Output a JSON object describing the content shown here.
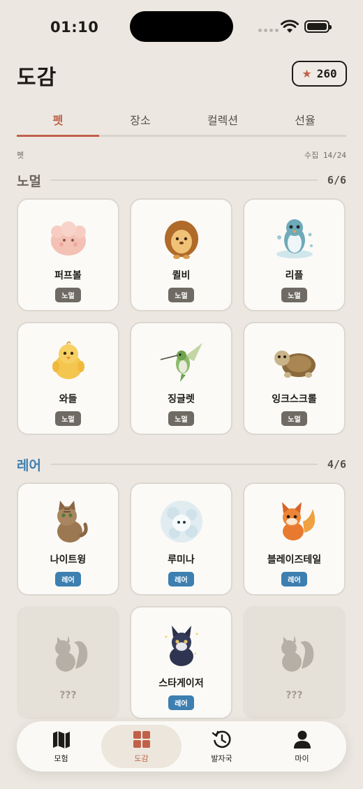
{
  "status_bar": {
    "time": "01:10"
  },
  "header": {
    "title": "도감",
    "stars": "260"
  },
  "tabs": [
    {
      "label": "펫",
      "active": true
    },
    {
      "label": "장소",
      "active": false
    },
    {
      "label": "컬렉션",
      "active": false
    },
    {
      "label": "선율",
      "active": false
    }
  ],
  "subheader": {
    "left": "펫",
    "right": "수집 14/24"
  },
  "sections": {
    "normal": {
      "title": "노멀",
      "progress": "6/6",
      "items": [
        {
          "name": "퍼프볼",
          "rarity": "노멀",
          "art": "pink-puffball-creature"
        },
        {
          "name": "퀼비",
          "rarity": "노멀",
          "art": "hedgehog"
        },
        {
          "name": "리플",
          "rarity": "노멀",
          "art": "water-penguin"
        },
        {
          "name": "와들",
          "rarity": "노멀",
          "art": "yellow-chick"
        },
        {
          "name": "징글렛",
          "rarity": "노멀",
          "art": "hummingbird"
        },
        {
          "name": "잉크스크롤",
          "rarity": "노멀",
          "art": "turtle"
        }
      ]
    },
    "rare": {
      "title": "레어",
      "progress": "4/6",
      "items": [
        {
          "name": "나이트윙",
          "rarity": "레어",
          "art": "tabby-cat",
          "locked": false
        },
        {
          "name": "루미나",
          "rarity": "레어",
          "art": "light-spirit",
          "locked": false
        },
        {
          "name": "블레이즈테일",
          "rarity": "레어",
          "art": "fire-fox",
          "locked": false
        },
        {
          "name": "???",
          "rarity": "",
          "art": "squirrel-silhouette",
          "locked": true
        },
        {
          "name": "스타게이저",
          "rarity": "레어",
          "art": "star-wolf-pup",
          "locked": false
        },
        {
          "name": "???",
          "rarity": "",
          "art": "squirrel-silhouette",
          "locked": true
        }
      ]
    }
  },
  "nav": [
    {
      "label": "모험",
      "icon": "map-icon",
      "active": false
    },
    {
      "label": "도감",
      "icon": "grid-icon",
      "active": true
    },
    {
      "label": "발자국",
      "icon": "history-icon",
      "active": false
    },
    {
      "label": "마이",
      "icon": "person-icon",
      "active": false
    }
  ],
  "colors": {
    "accent": "#c0614a",
    "rare": "#3d7fb0",
    "normal": "#6f6a63",
    "background": "#ece8e1"
  }
}
